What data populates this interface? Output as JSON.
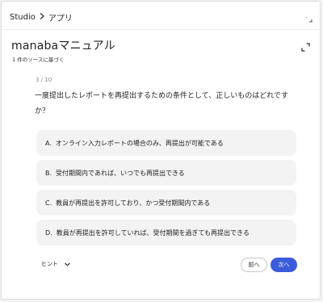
{
  "breadcrumb": {
    "root": "Studio",
    "current": "アプリ"
  },
  "title": "manabaマニュアル",
  "subtitle": "1 件のソースに基づく",
  "quiz": {
    "counter": "3 / 10",
    "question": "一度提出したレポートを再提出するための条件として、正しいものはどれですか？",
    "options": [
      {
        "letter": "A.",
        "text": "オンライン入力レポートの場合のみ、再提出が可能である"
      },
      {
        "letter": "B.",
        "text": "受付期間内であれば、いつでも再提出できる"
      },
      {
        "letter": "C.",
        "text": "教員が再提出を許可しており、かつ受付期間内である"
      },
      {
        "letter": "D.",
        "text": "教員が再提出を許可していれば、受付期間を過ぎても再提出できる"
      }
    ]
  },
  "footer": {
    "hint_label": "ヒント",
    "prev_label": "前へ",
    "next_label": "次へ"
  },
  "icons": {
    "breadcrumb_separator": "chevron-right-icon",
    "corner": "collapse-icon",
    "expand": "fullscreen-icon",
    "hint_toggle": "chevron-down-icon"
  },
  "colors": {
    "primary": "#3b5bdb",
    "option_bg": "#f3f3f4"
  }
}
